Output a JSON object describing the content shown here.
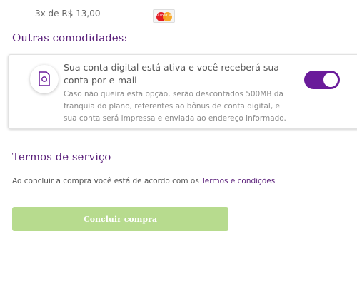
{
  "payment": {
    "installment_text": "3x de R$ 13,00",
    "card_brand_text": "MasterCard",
    "card_brand": "mastercard-icon"
  },
  "amenities": {
    "title": "Outras comodidades:",
    "digital_bill": {
      "main_text": "Sua conta digital está ativa e você receberá sua conta por e-mail",
      "sub_text": "Caso não queira esta opção, serão descontados 500MB da franquia do plano, referentes ao bônus de conta digital, e sua conta será impressa e enviada ao endereço informado.",
      "toggle_on": true,
      "toggle_color": "#6a1b9a",
      "icon": "email-document-icon"
    }
  },
  "terms": {
    "title": "Termos de serviço",
    "text": "Ao concluir a compra você está de acordo com os ",
    "link_text": "Termos e condições"
  },
  "actions": {
    "buy_label": "Concluir compra",
    "buy_color": "#b7db8e"
  },
  "colors": {
    "accent": "#5a1f7a"
  }
}
